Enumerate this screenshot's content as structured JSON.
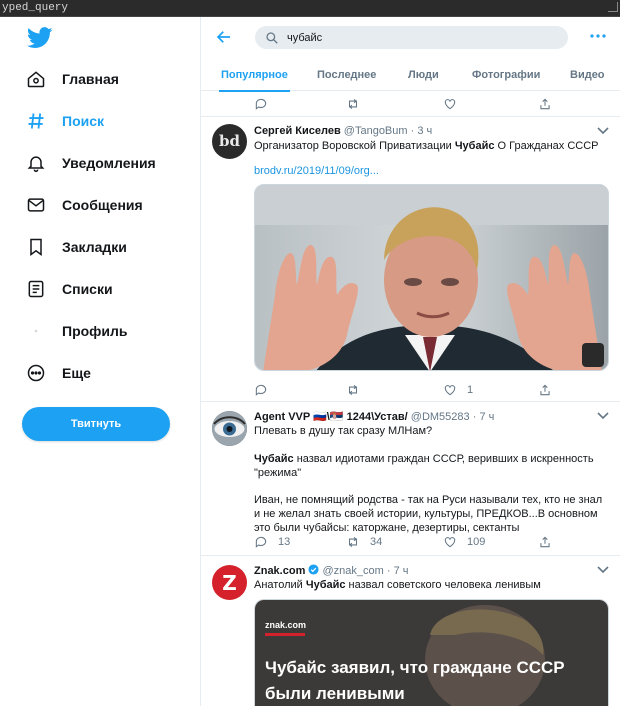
{
  "window": {
    "title": "yped_query"
  },
  "sidebar": {
    "logo_icon": "twitter-bird-icon",
    "items": [
      {
        "label": "Главная",
        "icon": "home-icon"
      },
      {
        "label": "Поиск",
        "icon": "hashtag-icon"
      },
      {
        "label": "Уведомления",
        "icon": "bell-icon"
      },
      {
        "label": "Сообщения",
        "icon": "envelope-icon"
      },
      {
        "label": "Закладки",
        "icon": "bookmark-icon"
      },
      {
        "label": "Списки",
        "icon": "list-icon"
      },
      {
        "label": "Профиль",
        "icon": "profile-icon"
      },
      {
        "label": "Еще",
        "icon": "more-circle-icon"
      }
    ],
    "tweet_button": "Твитнуть"
  },
  "colors": {
    "accent": "#1da1f2",
    "text": "#14171a",
    "muted": "#657786",
    "border": "#e6ecf0"
  },
  "search": {
    "value": "чубайс"
  },
  "tabs": [
    "Популярное",
    "Последнее",
    "Люди",
    "Фотографии",
    "Видео"
  ],
  "tweets": [
    {
      "name": "Сергей Киселев",
      "handle": "@TangoBum",
      "time": "· 3 ч",
      "text_before": "Организатор Воровской Приватизации ",
      "text_bold": "Чубайс",
      "text_after": " О Гражданах СССР",
      "link": "brodv.ru/2019/11/09/org...",
      "avatar_text": "bd",
      "likes": "1"
    },
    {
      "name": "Agent VVP 🇷🇺\\🇷🇸 1244\\Устав/",
      "handle": "@DM55283",
      "time": "· 7 ч",
      "line1": "Плевать в душу так сразу МЛНам?",
      "bold": "Чубайс",
      "line2": " назвал идиотами граждан СССР, веривших в искренность \"режима\"",
      "line3": "Иван, не помнящий родства - так на Руси  называли тех, кто не знал и не желал знать своей истории, культуры, ПРЕДКОВ...В основном это были чубайсы: каторжане, дезертиры, сектанты",
      "replies": "13",
      "retweets": "34",
      "likes": "109"
    },
    {
      "name": "Znak.com",
      "handle": "@znak_com",
      "time": "· 7 ч",
      "text_before": "Анатолий ",
      "text_bold": "Чубайс",
      "text_after": " назвал советского человека ленивым",
      "avatar_text": "Z",
      "card_brand": "znak.com",
      "card_headline_1": "Чубайс заявил, что граждане СССР",
      "card_headline_2": "были ленивыми"
    }
  ]
}
